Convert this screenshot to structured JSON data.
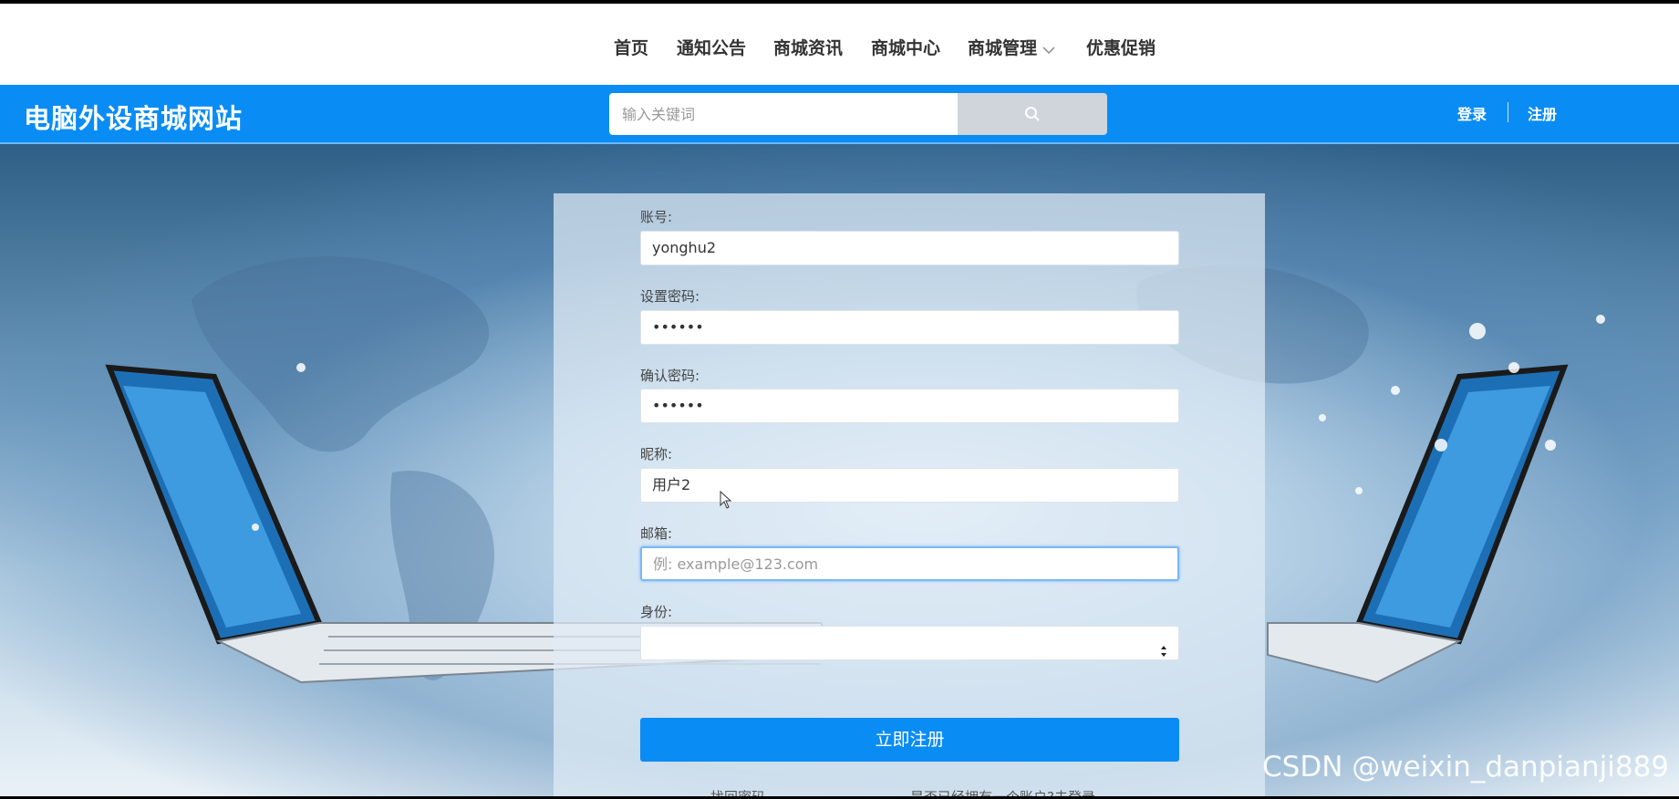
{
  "nav": {
    "items": [
      {
        "label": "首页"
      },
      {
        "label": "通知公告"
      },
      {
        "label": "商城资讯"
      },
      {
        "label": "商城中心"
      },
      {
        "label": "商城管理"
      },
      {
        "label": "优惠促销"
      }
    ]
  },
  "header": {
    "site_title": "电脑外设商城网站",
    "search_placeholder": "输入关键词",
    "login_label": "登录",
    "register_label": "注册"
  },
  "form": {
    "account_label": "账号:",
    "account_value": "yonghu2",
    "password_label": "设置密码:",
    "password_value": "••••••",
    "confirm_label": "确认密码:",
    "confirm_value": "••••••",
    "nickname_label": "昵称:",
    "nickname_value": "用户2",
    "email_label": "邮箱:",
    "email_placeholder": "例: example@123.com",
    "identity_label": "身份:",
    "identity_value": "",
    "submit_label": "立即注册",
    "forgot_label": "找回密码",
    "have_account_label": "是否已经拥有一个账户?去登录"
  },
  "watermark": "CSDN @weixin_danpianji889",
  "colors": {
    "primary": "#0a8cf5",
    "search_button": "#cfd5db"
  },
  "icons": {
    "search": "search-icon",
    "chevron": "chevron-down-icon",
    "select": "select-arrows-icon",
    "cursor": "mouse-cursor-icon"
  }
}
